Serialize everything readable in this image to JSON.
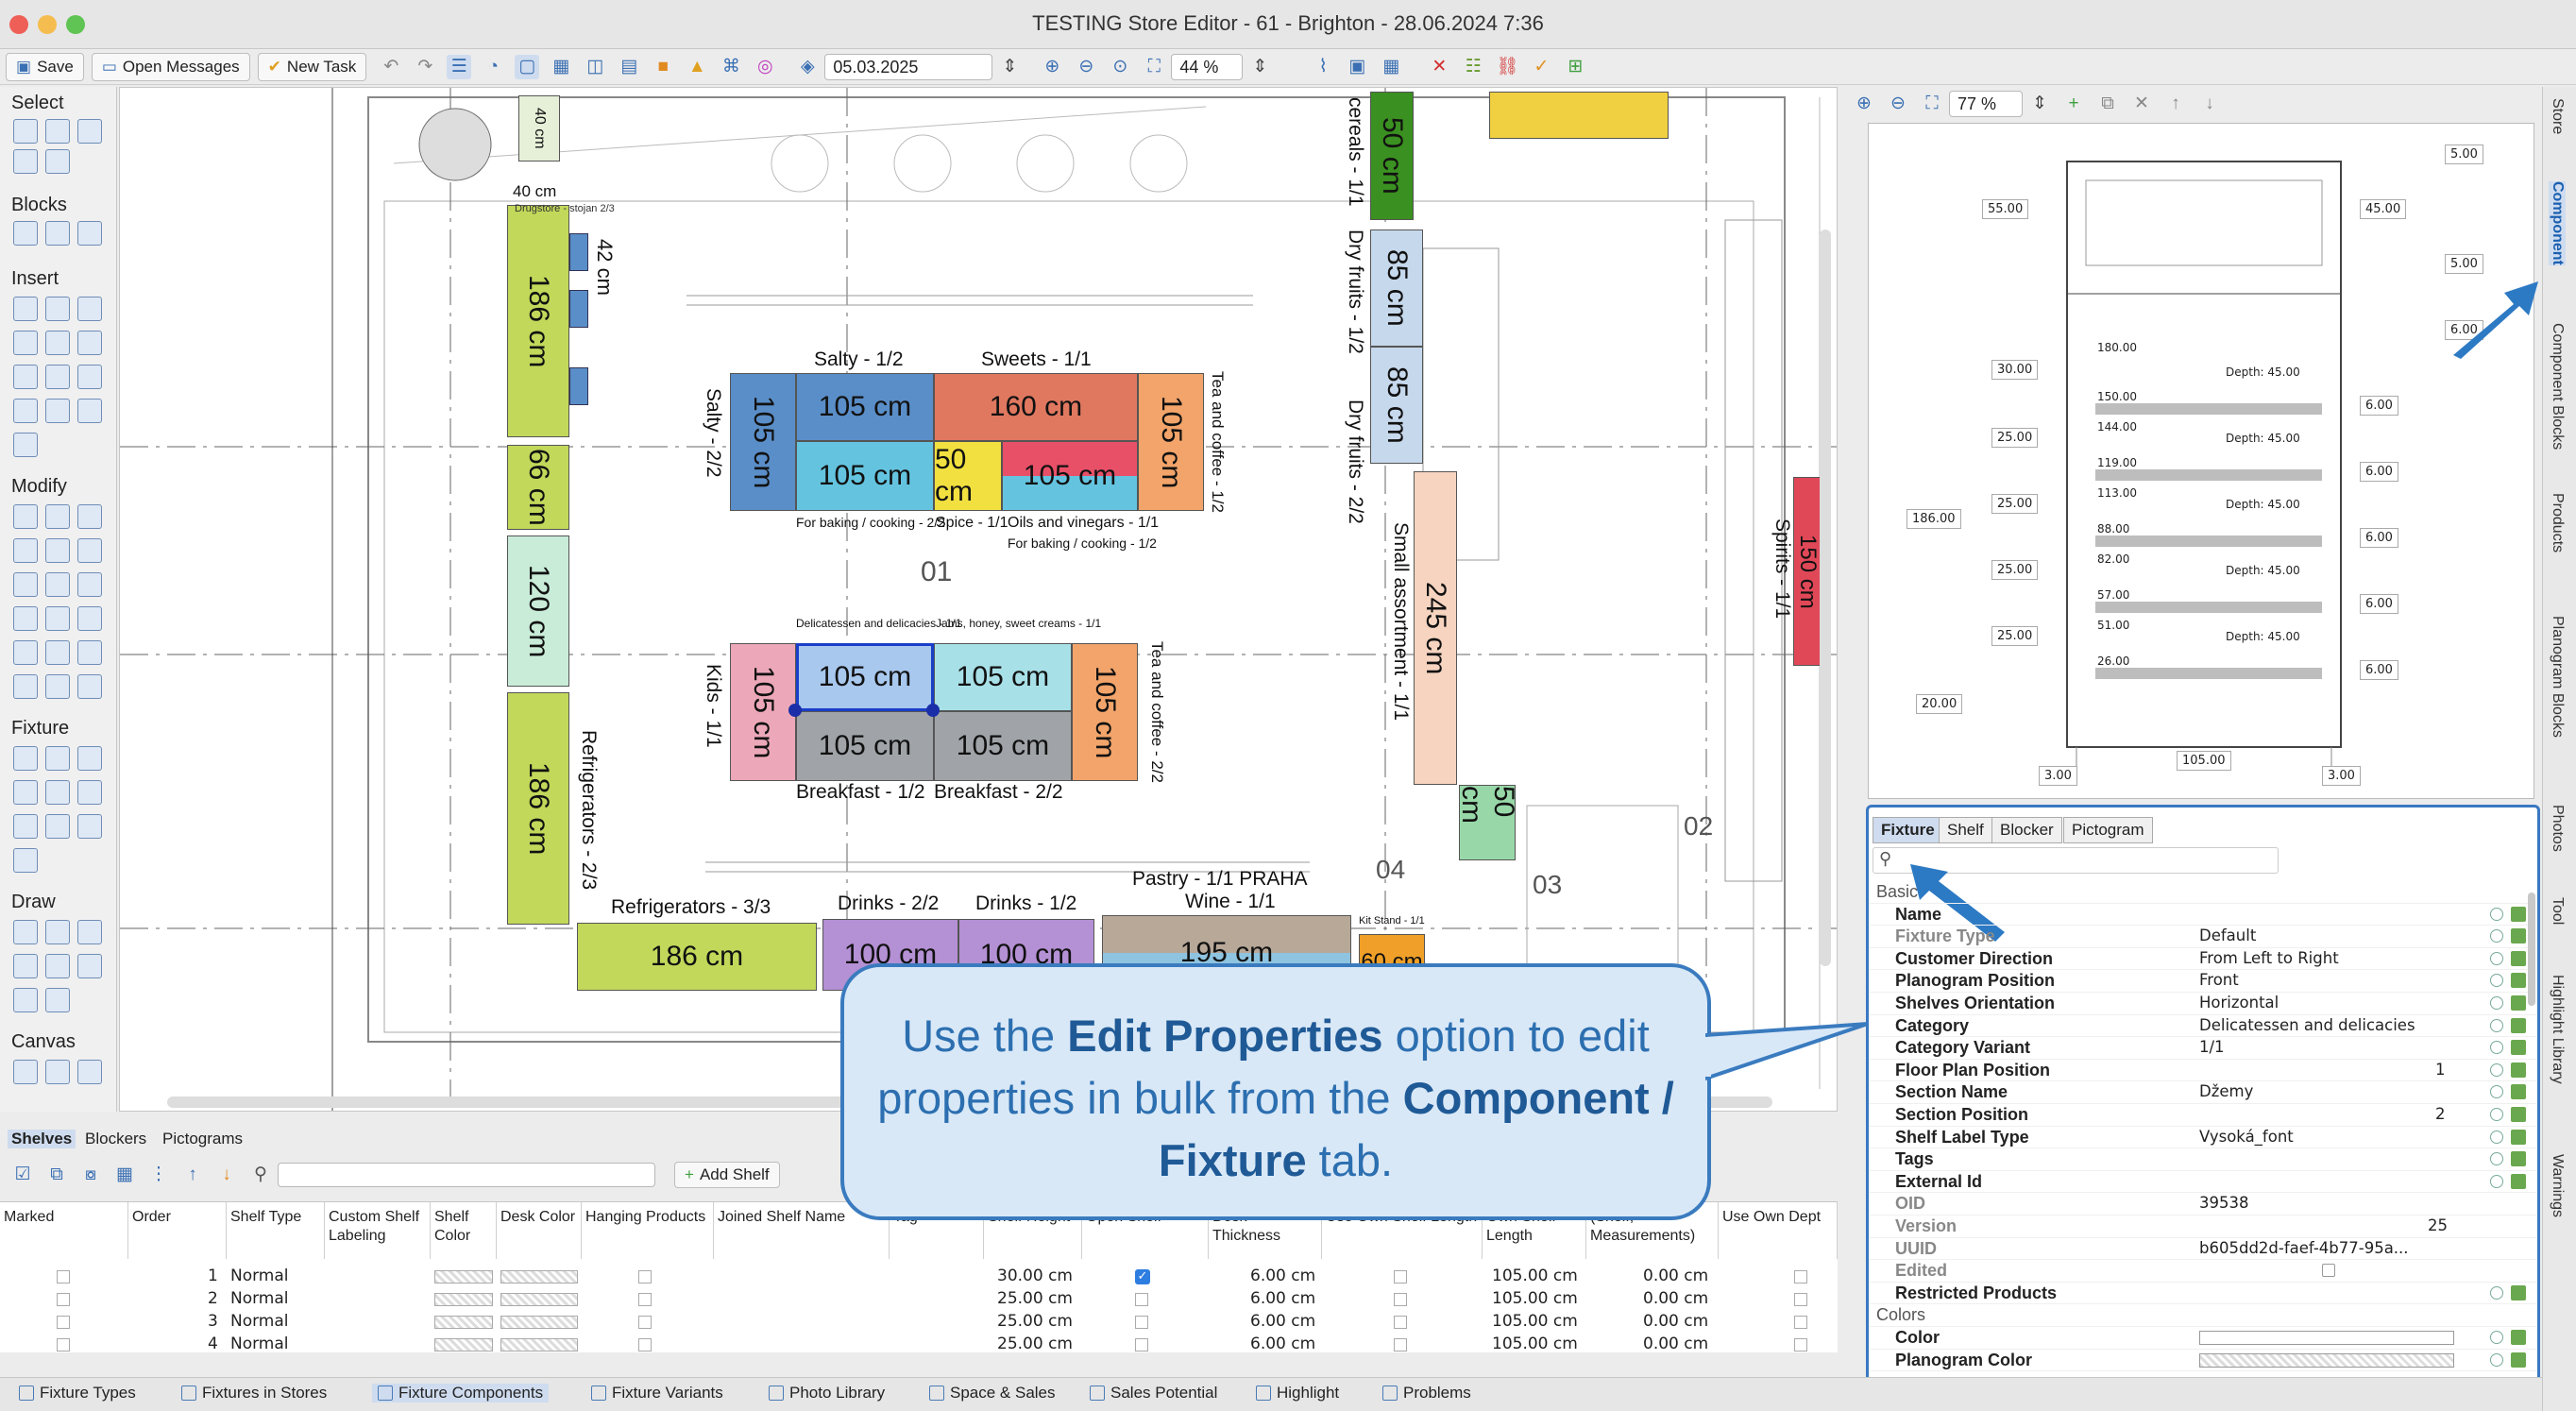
{
  "window": {
    "title": "TESTING Store Editor - 61 - Brighton - 28.06.2024 7:36"
  },
  "toolbar": {
    "save_label": "Save",
    "open_messages_label": "Open Messages",
    "new_task_label": "New Task",
    "date_value": "05.03.2025",
    "zoom_value": "44 %"
  },
  "palette": {
    "sections": [
      "Select",
      "Blocks",
      "Insert",
      "Modify",
      "Fixture",
      "Draw",
      "Canvas"
    ]
  },
  "canvas": {
    "fixtures": [
      {
        "label": "186 cm"
      },
      {
        "label": "66 cm"
      },
      {
        "label": "120 cm"
      },
      {
        "label": "186 cm"
      },
      {
        "label": "105 cm"
      },
      {
        "label": "105 cm"
      },
      {
        "label": "160 cm"
      },
      {
        "label": "105 cm"
      },
      {
        "label": "105 cm"
      },
      {
        "label": "50 cm"
      },
      {
        "label": "105 cm"
      },
      {
        "label": "105 cm"
      },
      {
        "label": "105 cm"
      },
      {
        "label": "105 cm"
      },
      {
        "label": "105 cm"
      },
      {
        "label": "105 cm"
      },
      {
        "label": "105 cm"
      },
      {
        "label": "186 cm"
      },
      {
        "label": "100 cm"
      },
      {
        "label": "100 cm"
      },
      {
        "label": "195 cm"
      },
      {
        "label": "60 cm"
      },
      {
        "label": "50 cm"
      },
      {
        "label": "85 cm"
      },
      {
        "label": "85 cm"
      },
      {
        "label": "245 cm"
      },
      {
        "label": "150 cm"
      },
      {
        "label": "50 cm"
      },
      {
        "label": "40 cm"
      },
      {
        "label": "42 cm"
      }
    ],
    "labels": {
      "salty_half": "Salty - 1/2",
      "sweets": "Sweets - 1/1",
      "salty_22": "Salty - 2/2",
      "tea_coffee_12": "Tea and coffee - 1/2",
      "for_baking_1": "For baking / cooking - 2/2",
      "spice": "Spice - 1/1",
      "oils": "Oils and vinegars - 1/1",
      "for_baking_2": "For baking / cooking - 1/2",
      "section_01": "01",
      "deli": "Delicatessen and delicacies - 1/1",
      "jams": "Jams, honey, sweet creams - 1/1",
      "kids": "Kids - 1/1",
      "tea_coffee_22": "Tea and coffee - 2/2",
      "breakfast_12": "Breakfast - 1/2",
      "breakfast_22": "Breakfast - 2/2",
      "refrigerators_33": "Refrigerators - 3/3",
      "refrigerators_23": "Refrigerators - 2/3",
      "drinks_22": "Drinks - 2/2",
      "drinks_12": "Drinks - 1/2",
      "pastry": "Pastry - 1/1 PRAHA",
      "wine": "Wine - 1/1",
      "dry_fruits": "Dry fruits - 1/2",
      "dry_fruits_22": "Dry fruits - 2/2",
      "cereals": "cereals - 1/1",
      "small_assortment": "Small assortment - 1/1",
      "spirits": "Spirits - 1/1",
      "kit_stand": "Kit Stand - 1/1",
      "section_02": "02",
      "section_03": "03",
      "section_04": "04",
      "dim_40": "40 cm",
      "drugstore": "Drugstore - stojan 2/3"
    }
  },
  "preview": {
    "zoom_value": "77 %",
    "dims": [
      "5.00",
      "55.00",
      "45.00",
      "5.00",
      "6.00",
      "30.00",
      "25.00",
      "25.00",
      "25.00",
      "25.00",
      "186.00",
      "20.00",
      "105.00",
      "3.00",
      "3.00",
      "6.00",
      "6.00",
      "6.00",
      "6.00",
      "6.00"
    ],
    "heights": [
      "180.00",
      "150.00",
      "144.00",
      "119.00",
      "113.00",
      "88.00",
      "82.00",
      "57.00",
      "51.00",
      "26.00"
    ],
    "depth": "Depth: 45.00"
  },
  "props": {
    "tabs": [
      "Fixture",
      "Shelf",
      "Blocker",
      "Pictogram"
    ],
    "group_basic": "Basic",
    "group_colors": "Colors",
    "rows": [
      {
        "name": "Name",
        "value": ""
      },
      {
        "name": "Fixture Type",
        "value": "Default"
      },
      {
        "name": "Customer Direction",
        "value": "From Left to Right"
      },
      {
        "name": "Planogram Position",
        "value": "Front"
      },
      {
        "name": "Shelves Orientation",
        "value": "Horizontal"
      },
      {
        "name": "Category",
        "value": "Delicatessen and delicacies"
      },
      {
        "name": "Category Variant",
        "value": "1/1"
      },
      {
        "name": "Floor Plan Position",
        "value": "1"
      },
      {
        "name": "Section Name",
        "value": "Džemy"
      },
      {
        "name": "Section Position",
        "value": "2"
      },
      {
        "name": "Shelf Label Type",
        "value": "Vysoká_font"
      },
      {
        "name": "Tags",
        "value": ""
      },
      {
        "name": "External Id",
        "value": ""
      },
      {
        "name": "OID",
        "value": "39538"
      },
      {
        "name": "Version",
        "value": "25"
      },
      {
        "name": "UUID",
        "value": "b605dd2d-faef-4b77-95a..."
      },
      {
        "name": "Edited",
        "value": ""
      },
      {
        "name": "Restricted Products",
        "value": ""
      }
    ],
    "color_rows": [
      {
        "name": "Color"
      },
      {
        "name": "Planogram Color"
      }
    ]
  },
  "right_tabs": [
    "Store",
    "Component",
    "Component Blocks",
    "Products",
    "Planogram Blocks",
    "Photos",
    "Tool",
    "Highlight Library",
    "Warnings"
  ],
  "bottom": {
    "tabs": [
      "Shelves",
      "Blockers",
      "Pictograms"
    ],
    "add_shelf_label": "Add Shelf",
    "columns": [
      "Marked",
      "Order",
      "Shelf Type",
      "Custom Shelf Labeling",
      "Shelf Color",
      "Desk Color",
      "Hanging Products",
      "Joined Shelf Name",
      "Tag",
      "Shelf Height",
      "Open Shelf",
      "Desk Thickness",
      "Use Own Shelf Length",
      "Own Shelf Length",
      "(Shelf, Measurements)",
      "Use Own Dept"
    ],
    "rows": [
      {
        "order": "1",
        "type": "Normal",
        "height": "30.00 cm",
        "open": true,
        "desk": "6.00 cm",
        "length": "105.00 cm",
        "meas": "0.00 cm"
      },
      {
        "order": "2",
        "type": "Normal",
        "height": "25.00 cm",
        "open": false,
        "desk": "6.00 cm",
        "length": "105.00 cm",
        "meas": "0.00 cm"
      },
      {
        "order": "3",
        "type": "Normal",
        "height": "25.00 cm",
        "open": false,
        "desk": "6.00 cm",
        "length": "105.00 cm",
        "meas": "0.00 cm"
      },
      {
        "order": "4",
        "type": "Normal",
        "height": "25.00 cm",
        "open": false,
        "desk": "6.00 cm",
        "length": "105.00 cm",
        "meas": "0.00 cm"
      }
    ]
  },
  "status_tabs": [
    "Fixture Types",
    "Fixtures in Stores",
    "Fixture Components",
    "Fixture Variants",
    "Photo Library",
    "Space & Sales",
    "Sales Potential",
    "Highlight",
    "Problems"
  ],
  "callout": {
    "part1": "Use the ",
    "bold1": "Edit Properties",
    "part2": " option to edit properties in bulk from the ",
    "bold2": "Component / Fixture",
    "part3": " tab."
  }
}
